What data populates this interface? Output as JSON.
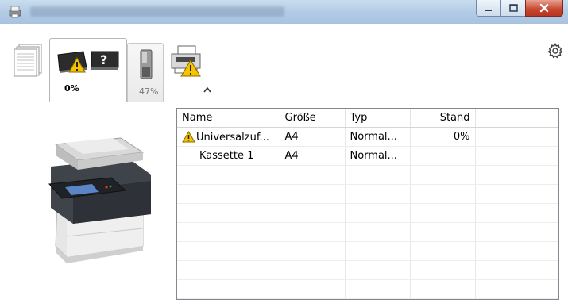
{
  "window": {
    "title": "",
    "buttons": {
      "minimize": "–",
      "maximize": "□",
      "close": "X"
    }
  },
  "toolbar": {
    "tabs": [
      {
        "name": "pages",
        "percent": ""
      },
      {
        "name": "toner-alert",
        "percent": "0%"
      },
      {
        "name": "waste-toner",
        "percent": "47%"
      },
      {
        "name": "printer-alert",
        "percent": ""
      }
    ],
    "settings_icon": "gear-icon",
    "collapse_icon": "chevron-up-icon"
  },
  "table": {
    "columns": [
      "Name",
      "Größe",
      "Typ",
      "Stand"
    ],
    "rows": [
      {
        "icon": "warning-icon",
        "name": "Universalzuf...",
        "size": "A4",
        "type": "Normal...",
        "level": "0%"
      },
      {
        "icon": "",
        "name": "Kassette 1",
        "size": "A4",
        "type": "Normal...",
        "level": ""
      }
    ]
  },
  "colors": {
    "titlebar": "#b5cde6",
    "warning": "#f5c400",
    "close_button": "#c6452e"
  }
}
